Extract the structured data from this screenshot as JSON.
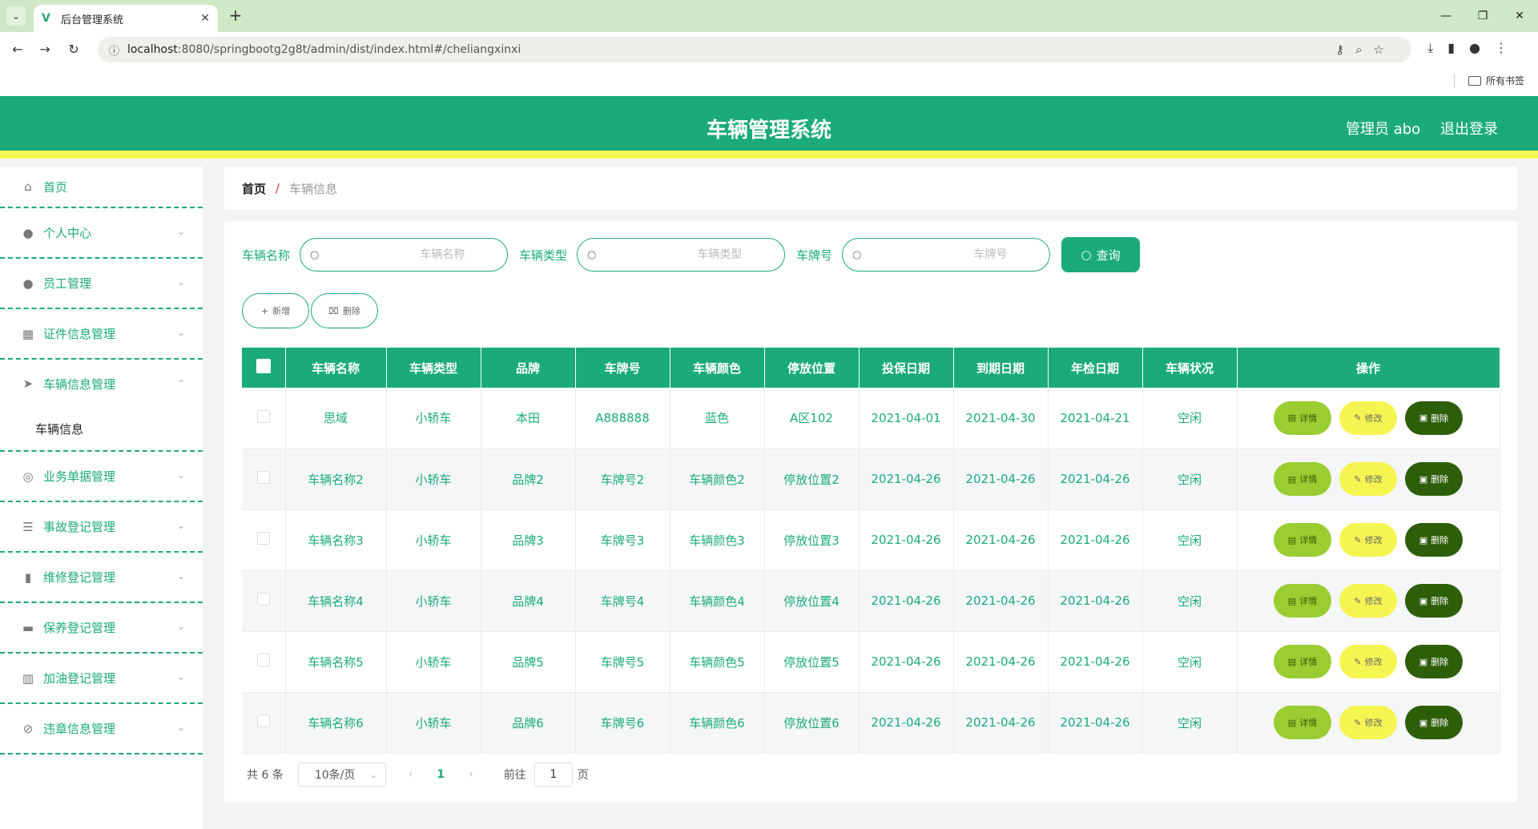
{
  "browser": {
    "tab_title": "后台管理系统",
    "url_host": "localhost",
    "url_rest": ":8080/springbootg2g8t/admin/dist/index.html#/cheliangxinxi",
    "bookmarks_label": "所有书签"
  },
  "header": {
    "title": "车辆管理系统",
    "admin_label": "管理员 abo",
    "logout": "退出登录"
  },
  "sidebar": {
    "items": [
      {
        "label": "首页",
        "icon": "home-icon"
      },
      {
        "label": "个人中心",
        "icon": "user-icon"
      },
      {
        "label": "员工管理",
        "icon": "user-icon"
      },
      {
        "label": "证件信息管理",
        "icon": "grid-icon"
      },
      {
        "label": "车辆信息管理",
        "icon": "send-icon",
        "expanded": true
      },
      {
        "label": "业务单据管理",
        "icon": "target-icon"
      },
      {
        "label": "事故登记管理",
        "icon": "list-icon"
      },
      {
        "label": "维修登记管理",
        "icon": "bar-chart-icon"
      },
      {
        "label": "保养登记管理",
        "icon": "brush-icon"
      },
      {
        "label": "加油登记管理",
        "icon": "bars-icon"
      },
      {
        "label": "违章信息管理",
        "icon": "compass-icon"
      }
    ],
    "submenu_item": "车辆信息"
  },
  "breadcrumb": {
    "home": "首页",
    "separator": "/",
    "current": "车辆信息"
  },
  "search": {
    "name_label": "车辆名称",
    "name_placeholder": "车辆名称",
    "type_label": "车辆类型",
    "type_placeholder": "车辆类型",
    "plate_label": "车牌号",
    "plate_placeholder": "车牌号",
    "query_button": "查询"
  },
  "actions": {
    "add": "新增",
    "delete": "删除"
  },
  "table": {
    "columns": [
      "车辆名称",
      "车辆类型",
      "品牌",
      "车牌号",
      "车辆颜色",
      "停放位置",
      "投保日期",
      "到期日期",
      "年检日期",
      "车辆状况",
      "操作"
    ],
    "rows": [
      [
        "思域",
        "小轿车",
        "本田",
        "A888888",
        "蓝色",
        "A区102",
        "2021-04-01",
        "2021-04-30",
        "2021-04-21",
        "空闲"
      ],
      [
        "车辆名称2",
        "小轿车",
        "品牌2",
        "车牌号2",
        "车辆颜色2",
        "停放位置2",
        "2021-04-26",
        "2021-04-26",
        "2021-04-26",
        "空闲"
      ],
      [
        "车辆名称3",
        "小轿车",
        "品牌3",
        "车牌号3",
        "车辆颜色3",
        "停放位置3",
        "2021-04-26",
        "2021-04-26",
        "2021-04-26",
        "空闲"
      ],
      [
        "车辆名称4",
        "小轿车",
        "品牌4",
        "车牌号4",
        "车辆颜色4",
        "停放位置4",
        "2021-04-26",
        "2021-04-26",
        "2021-04-26",
        "空闲"
      ],
      [
        "车辆名称5",
        "小轿车",
        "品牌5",
        "车牌号5",
        "车辆颜色5",
        "停放位置5",
        "2021-04-26",
        "2021-04-26",
        "2021-04-26",
        "空闲"
      ],
      [
        "车辆名称6",
        "小轿车",
        "品牌6",
        "车牌号6",
        "车辆颜色6",
        "停放位置6",
        "2021-04-26",
        "2021-04-26",
        "2021-04-26",
        "空闲"
      ]
    ],
    "op_detail": "详情",
    "op_edit": "修改",
    "op_delete": "删除"
  },
  "pagination": {
    "total": "共 6 条",
    "page_size": "10条/页",
    "current_page": "1",
    "goto_prefix": "前往",
    "goto_value": "1",
    "goto_suffix": "页"
  },
  "colors": {
    "primary": "#1bab78",
    "accent_yellow": "#f5f552",
    "detail_btn": "#9acd32",
    "delete_btn": "#2e5e0a"
  }
}
